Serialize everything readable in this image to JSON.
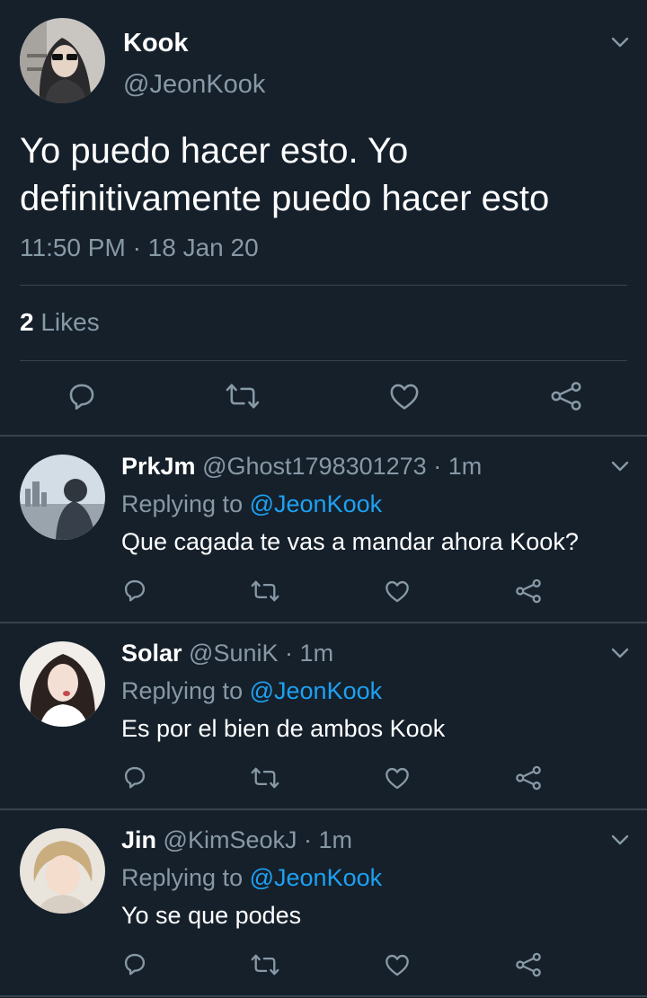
{
  "main": {
    "name": "Kook",
    "handle": "@JeonKook",
    "text": "Yo puedo hacer esto. Yo definitivamente puedo hacer esto",
    "time": "11:50 PM",
    "separator": "·",
    "date": "18 Jan 20",
    "likes_count": "2",
    "likes_label": "Likes"
  },
  "replies": [
    {
      "name": "PrkJm",
      "handle": "@Ghost1798301273",
      "dot": "·",
      "time": "1m",
      "replying_prefix": "Replying to",
      "mention": "@JeonKook",
      "text": "Que cagada te vas a mandar ahora Kook?"
    },
    {
      "name": "Solar",
      "handle": "@SuniK",
      "dot": "·",
      "time": "1m",
      "replying_prefix": "Replying to",
      "mention": "@JeonKook",
      "text": "Es por el bien de ambos Kook"
    },
    {
      "name": "Jin",
      "handle": "@KimSeokJ",
      "dot": "·",
      "time": "1m",
      "replying_prefix": "Replying to",
      "mention": "@JeonKook",
      "text": "Yo se que podes"
    }
  ],
  "colors": {
    "background": "#15202b",
    "secondary_text": "#8899a6",
    "accent": "#1da1f2",
    "divider": "#38444d"
  }
}
